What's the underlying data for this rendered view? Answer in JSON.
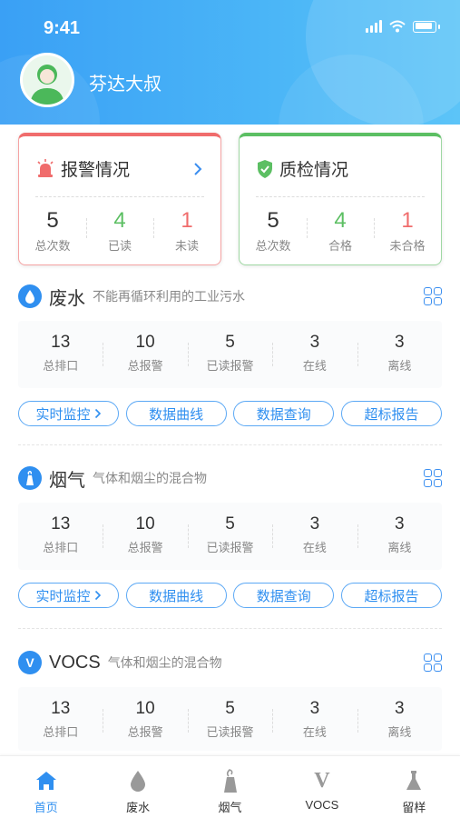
{
  "status_bar": {
    "time": "9:41"
  },
  "user": {
    "name": "芬达大叔"
  },
  "alarm_card": {
    "title": "报警情况",
    "stats": [
      {
        "value": "5",
        "label": "总次数"
      },
      {
        "value": "4",
        "label": "已读"
      },
      {
        "value": "1",
        "label": "未读"
      }
    ]
  },
  "qc_card": {
    "title": "质检情况",
    "stats": [
      {
        "value": "5",
        "label": "总次数"
      },
      {
        "value": "4",
        "label": "合格"
      },
      {
        "value": "1",
        "label": "未合格"
      }
    ]
  },
  "sections": [
    {
      "title": "废水",
      "desc": "不能再循环利用的工业污水",
      "stats": [
        {
          "value": "13",
          "label": "总排口"
        },
        {
          "value": "10",
          "label": "总报警"
        },
        {
          "value": "5",
          "label": "已读报警"
        },
        {
          "value": "3",
          "label": "在线"
        },
        {
          "value": "3",
          "label": "离线"
        }
      ],
      "buttons": [
        "实时监控",
        "数据曲线",
        "数据查询",
        "超标报告"
      ]
    },
    {
      "title": "烟气",
      "desc": "气体和烟尘的混合物",
      "stats": [
        {
          "value": "13",
          "label": "总排口"
        },
        {
          "value": "10",
          "label": "总报警"
        },
        {
          "value": "5",
          "label": "已读报警"
        },
        {
          "value": "3",
          "label": "在线"
        },
        {
          "value": "3",
          "label": "离线"
        }
      ],
      "buttons": [
        "实时监控",
        "数据曲线",
        "数据查询",
        "超标报告"
      ]
    },
    {
      "title": "VOCS",
      "desc": "气体和烟尘的混合物",
      "icon_text": "V",
      "stats": [
        {
          "value": "13",
          "label": "总排口"
        },
        {
          "value": "10",
          "label": "总报警"
        },
        {
          "value": "5",
          "label": "已读报警"
        },
        {
          "value": "3",
          "label": "在线"
        },
        {
          "value": "3",
          "label": "离线"
        }
      ]
    }
  ],
  "tabbar": [
    {
      "label": "首页",
      "icon": "home-icon",
      "active": true
    },
    {
      "label": "废水",
      "icon": "water-drop-icon"
    },
    {
      "label": "烟气",
      "icon": "chimney-icon"
    },
    {
      "label": "VOCS",
      "icon": "vocs-icon",
      "icon_text": "V"
    },
    {
      "label": "留样",
      "icon": "flask-icon"
    }
  ],
  "colors": {
    "header": "#3aa0f5",
    "accent": "#2f8ff0",
    "alarm": "#f06c6c",
    "ok": "#5cbf63"
  }
}
